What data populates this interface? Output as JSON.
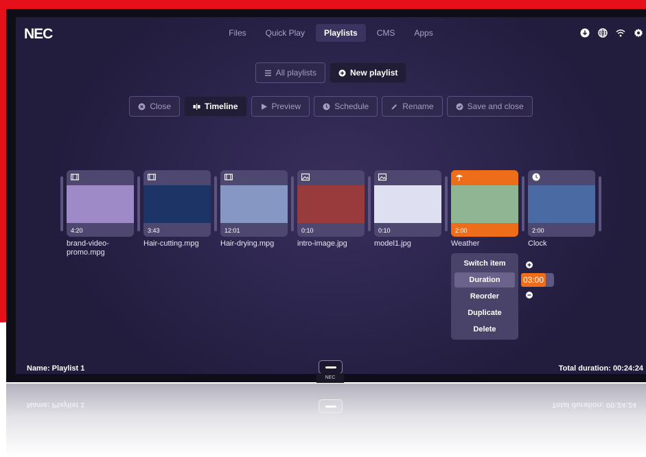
{
  "brand": {
    "logo_text": "NEC",
    "bezel_text": "NEC"
  },
  "nav": {
    "items": [
      {
        "label": "Files"
      },
      {
        "label": "Quick Play"
      },
      {
        "label": "Playlists"
      },
      {
        "label": "CMS"
      },
      {
        "label": "Apps"
      }
    ],
    "active": "Playlists"
  },
  "top_icons": [
    "download-icon",
    "globe-icon",
    "wifi-icon",
    "gear-icon"
  ],
  "playlist_actions": {
    "all_playlists": "All playlists",
    "new_playlist": "New playlist"
  },
  "toolbar": {
    "close": "Close",
    "timeline": "Timeline",
    "preview": "Preview",
    "schedule": "Schedule",
    "rename": "Rename",
    "save_and_close": "Save and close"
  },
  "items": [
    {
      "name": "brand-video-promo.mpg",
      "duration": "4:20",
      "type_icon": "film-icon",
      "color": "#9f8ac8"
    },
    {
      "name": "Hair-cutting.mpg",
      "duration": "3:43",
      "type_icon": "film-icon",
      "color": "#1d3566"
    },
    {
      "name": "Hair-drying.mpg",
      "duration": "12:01",
      "type_icon": "film-icon",
      "color": "#8797c4"
    },
    {
      "name": "intro-image.jpg",
      "duration": "0:10",
      "type_icon": "image-icon",
      "color": "#993a3d"
    },
    {
      "name": "model1.jpg",
      "duration": "0:10",
      "type_icon": "image-icon",
      "color": "#dedff0"
    },
    {
      "name": "Weather",
      "duration": "2:00",
      "type_icon": "umbrella-icon",
      "color": "#8fb593",
      "selected": true
    },
    {
      "name": "Clock",
      "duration": "2:00",
      "type_icon": "clock-icon",
      "color": "#4a6aa4"
    }
  ],
  "context_menu": {
    "switch_item": "Switch item",
    "duration": "Duration",
    "reorder": "Reorder",
    "duplicate": "Duplicate",
    "delete": "Delete"
  },
  "duration_editor": {
    "value": "03:00"
  },
  "footer": {
    "name": "Name: Playlist 1",
    "total": "Total duration: 00:24:24"
  },
  "colors": {
    "background_red": "#e5101a",
    "accent_orange": "#ee6d1a",
    "screen_purple": "#2e2750"
  }
}
